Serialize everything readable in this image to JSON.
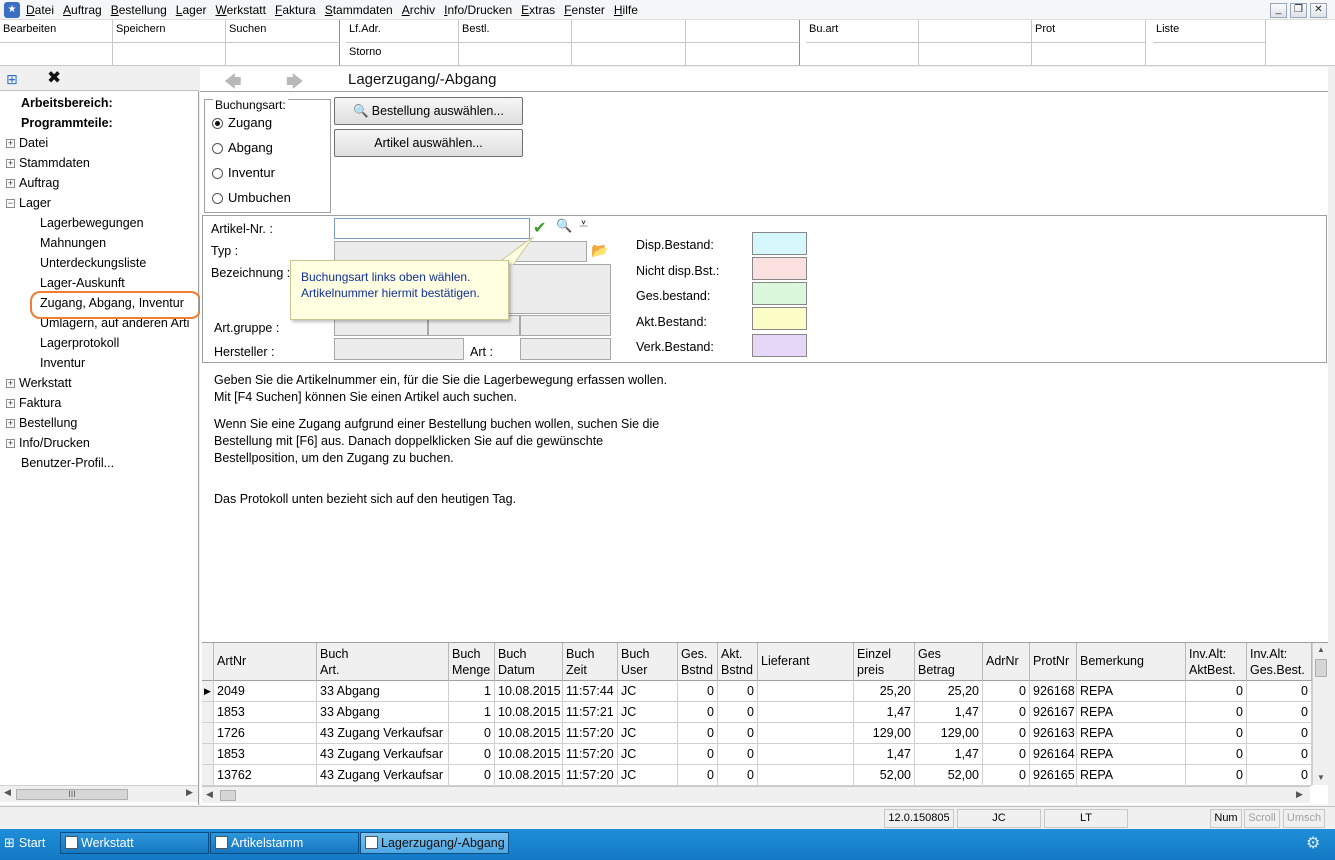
{
  "menubar": {
    "items": [
      "Datei",
      "Auftrag",
      "Bestellung",
      "Lager",
      "Werkstatt",
      "Faktura",
      "Stammdaten",
      "Archiv",
      "Info/Drucken",
      "Extras",
      "Fenster",
      "Hilfe"
    ]
  },
  "toolbar": {
    "bearbeiten": "Bearbeiten",
    "speichern": "Speichern",
    "suchen": "Suchen",
    "lf_adr": "Lf.Adr.",
    "storno": "Storno",
    "bestl": "Bestl.",
    "bu_art": "Bu.art",
    "prot": "Prot",
    "liste": "Liste"
  },
  "tree": {
    "workspace": "Arbeitsbereich:",
    "program_parts": "Programmteile:",
    "items": [
      {
        "label": "Datei"
      },
      {
        "label": "Stammdaten"
      },
      {
        "label": "Auftrag"
      },
      {
        "label": "Lager"
      },
      {
        "label": "Lagerbewegungen"
      },
      {
        "label": "Mahnungen"
      },
      {
        "label": "Unterdeckungsliste"
      },
      {
        "label": "Lager-Auskunft"
      },
      {
        "label": "Zugang, Abgang, Inventur"
      },
      {
        "label": "Umlagern, auf anderen Arti"
      },
      {
        "label": "Lagerprotokoll"
      },
      {
        "label": "Inventur"
      },
      {
        "label": "Werkstatt"
      },
      {
        "label": "Faktura"
      },
      {
        "label": "Bestellung"
      },
      {
        "label": "Info/Drucken"
      },
      {
        "label": "Benutzer-Profil..."
      }
    ],
    "hscroll_grip": "III"
  },
  "page": {
    "title": "Lagerzugang/-Abgang"
  },
  "booking": {
    "legend": "Buchungsart:",
    "options": [
      "Zugang",
      "Abgang",
      "Inventur",
      "Umbuchen"
    ],
    "selected": "Zugang",
    "btn_order": "Bestellung auswählen...",
    "btn_article": "Artikel auswählen..."
  },
  "article": {
    "nr_label": "Artikel-Nr. :",
    "typ_label": "Typ :",
    "desc_label": "Bezeichnung :",
    "group_label": "Art.gruppe :",
    "maker_label": "Hersteller :",
    "art_label": "Art :"
  },
  "stock": {
    "labels": [
      "Disp.Bestand:",
      "Nicht disp.Bst.:",
      "Ges.bestand:",
      "Akt.Bestand:",
      "Verk.Bestand:"
    ],
    "colors": [
      "#d6f7fb",
      "#fbe0e0",
      "#dcf8dc",
      "#fdfdc8",
      "#e6d6f8"
    ]
  },
  "tooltip": {
    "line1": "Buchungsart links oben wählen.",
    "line2": "Artikelnummer hiermit bestätigen."
  },
  "info": {
    "p1": "Geben Sie die Artikelnummer ein, für die Sie die Lagerbewegung erfassen wollen. Mit [F4 Suchen] können Sie einen Artikel auch suchen.",
    "p2": "Wenn Sie eine Zugang aufgrund einer Bestellung buchen wollen, suchen Sie die Bestellung mit [F6] aus. Danach doppelklicken Sie auf die gewünschte Bestellposition, um den Zugang zu buchen.",
    "p3": "Das Protokoll unten bezieht sich auf den heutigen Tag."
  },
  "table": {
    "columns": [
      "ArtNr",
      "Buch\nArt.",
      "Buch\nMenge",
      "Buch\nDatum",
      "Buch\nZeit",
      "Buch\nUser",
      "Ges.\nBstnd",
      "Akt.\nBstnd",
      "Lieferant",
      "Einzel\npreis",
      "Ges\nBetrag",
      "AdrNr",
      "ProtNr",
      "Bemerkung",
      "Inv.Alt:\nAktBest.",
      "Inv.Alt:\nGes.Best."
    ],
    "rows": [
      [
        "2049",
        "33 Abgang",
        "1",
        "10.08.2015",
        "11:57:44",
        "JC",
        "0",
        "0",
        "",
        "25,20",
        "25,20",
        "0",
        "926168",
        "REPA",
        "0",
        "0"
      ],
      [
        "1853",
        "33 Abgang",
        "1",
        "10.08.2015",
        "11:57:21",
        "JC",
        "0",
        "0",
        "",
        "1,47",
        "1,47",
        "0",
        "926167",
        "REPA",
        "0",
        "0"
      ],
      [
        "1726",
        "43 Zugang Verkaufsar",
        "0",
        "10.08.2015",
        "11:57:20",
        "JC",
        "0",
        "0",
        "",
        "129,00",
        "129,00",
        "0",
        "926163",
        "REPA",
        "0",
        "0"
      ],
      [
        "1853",
        "43 Zugang Verkaufsar",
        "0",
        "10.08.2015",
        "11:57:20",
        "JC",
        "0",
        "0",
        "",
        "1,47",
        "1,47",
        "0",
        "926164",
        "REPA",
        "0",
        "0"
      ],
      [
        "13762",
        "43 Zugang Verkaufsar",
        "0",
        "10.08.2015",
        "11:57:20",
        "JC",
        "0",
        "0",
        "",
        "52,00",
        "52,00",
        "0",
        "926165",
        "REPA",
        "0",
        "0"
      ]
    ]
  },
  "status": {
    "version": "12.0.150805",
    "user": "JC",
    "lt": "LT",
    "num": "Num",
    "scroll": "Scroll",
    "umsch": "Umsch"
  },
  "taskbar": {
    "start": "Start",
    "tasks": [
      "Werkstatt",
      "Artikelstamm",
      "Lagerzugang/-Abgang"
    ]
  }
}
